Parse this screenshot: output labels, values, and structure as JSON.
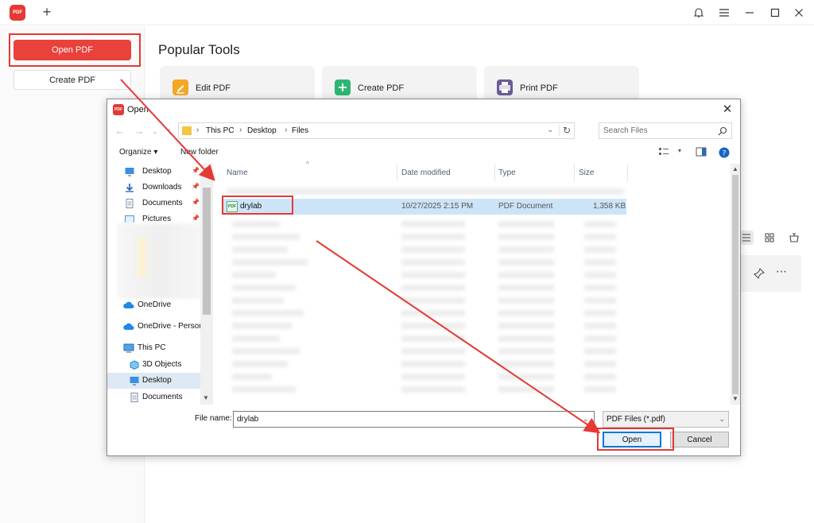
{
  "app": {
    "logo_text": "PDF",
    "window_controls": [
      "bell-icon",
      "menu-icon",
      "minimize-icon",
      "maximize-icon",
      "close-icon"
    ]
  },
  "sidebar": {
    "open_pdf": "Open PDF",
    "create_pdf": "Create PDF"
  },
  "main": {
    "popular_title": "Popular Tools",
    "tools": [
      {
        "label": "Edit PDF",
        "color": "#f5a623"
      },
      {
        "label": "Create PDF",
        "color": "#2bb673"
      },
      {
        "label": "Print PDF",
        "color": "#6b5b95"
      }
    ]
  },
  "dialog": {
    "title": "Open",
    "breadcrumb": [
      "This PC",
      "Desktop",
      "Files"
    ],
    "search_placeholder": "Search Files",
    "organize": "Organize ▾",
    "new_folder": "New folder",
    "nav_items": [
      {
        "label": "Desktop",
        "icon": "desktop-icon",
        "pinned": true
      },
      {
        "label": "Downloads",
        "icon": "download-icon",
        "pinned": true
      },
      {
        "label": "Documents",
        "icon": "document-icon",
        "pinned": true
      },
      {
        "label": "Pictures",
        "icon": "picture-icon",
        "pinned": true
      },
      {
        "label": "OneDrive",
        "icon": "cloud-icon"
      },
      {
        "label": "OneDrive - Person",
        "icon": "cloud-icon"
      },
      {
        "label": "This PC",
        "icon": "computer-icon"
      },
      {
        "label": "3D Objects",
        "icon": "cube-icon"
      },
      {
        "label": "Desktop",
        "icon": "desktop-icon",
        "selected": true
      },
      {
        "label": "Documents",
        "icon": "document-icon"
      }
    ],
    "columns": [
      "Name",
      "Date modified",
      "Type",
      "Size"
    ],
    "selected_file": {
      "name": "drylab",
      "date": "10/27/2025 2:15 PM",
      "type": "PDF Document",
      "size": "1,358 KB",
      "icon_text": "PDF"
    },
    "file_name_label": "File name:",
    "file_name_value": "drylab",
    "file_filter": "PDF Files (*.pdf)",
    "open_button": "Open",
    "cancel_button": "Cancel"
  },
  "colors": {
    "accent_red": "#e9413b",
    "annotation_red": "#e53935",
    "selection_blue": "#cce4f7"
  }
}
